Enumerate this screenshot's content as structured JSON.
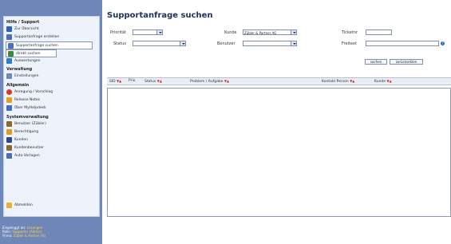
{
  "sidebar": {
    "sections": [
      {
        "title": "Hilfe / Support",
        "items": [
          {
            "label": "Zur Übersicht",
            "icon": "back-arrow-icon",
            "color": "#2f5fc4"
          },
          {
            "label": "Supportanfrage erstellen",
            "icon": "new-document-icon",
            "color": "#4a6fb8"
          },
          {
            "label": "Supportanfrage suchen",
            "icon": "search-document-icon",
            "color": "#4a6fb8"
          },
          {
            "label": "direkt suchen",
            "icon": "quick-search-icon",
            "color": "#3a8a3a"
          },
          {
            "label": "Auswertungen",
            "icon": "report-icon",
            "color": "#2f7fc4"
          }
        ]
      },
      {
        "title": "Verwaltung",
        "items": [
          {
            "label": "Einstellungen",
            "icon": "settings-icon",
            "color": "#6a8ac0"
          }
        ]
      },
      {
        "title": "Allgemein",
        "items": [
          {
            "label": "Anregung / Vorschlag",
            "icon": "suggestion-icon",
            "color": "#d23b2a"
          },
          {
            "label": "Release Notes",
            "icon": "release-notes-icon",
            "color": "#e0a020"
          },
          {
            "label": "Über MyHelpdesk",
            "icon": "info-icon",
            "color": "#3a6fc4"
          }
        ]
      },
      {
        "title": "Systemverwaltung",
        "items": [
          {
            "label": "Benutzer (Zübler)",
            "icon": "users-icon",
            "color": "#8a6a30"
          },
          {
            "label": "Berechtigung",
            "icon": "key-icon",
            "color": "#d8a020"
          },
          {
            "label": "Kunden",
            "icon": "customer-icon",
            "color": "#2a4a8a"
          },
          {
            "label": "Kundenbenutzer",
            "icon": "customer-users-icon",
            "color": "#8a6a30"
          },
          {
            "label": "Auto Vorlagen",
            "icon": "template-icon",
            "color": "#4a6fb8"
          }
        ]
      }
    ],
    "logout": {
      "label": "Abmelden",
      "icon": "logout-icon",
      "color": "#e8b030"
    },
    "footer": {
      "logged_in_label": "Eingeloggt als:",
      "logged_in_value": "Lösungen",
      "role_label": "Rolle:",
      "role_value": "Supporter (Admin)",
      "client_label": "Firma:",
      "client_value": "Zübler & Partner AG"
    }
  },
  "main": {
    "title": "Supportanfrage suchen",
    "filters": {
      "prioritaet_label": "Priorität",
      "prioritaet_value": "",
      "status_label": "Status",
      "status_value": "",
      "kunde_label": "Kunde",
      "kunde_value": "Zübler & Partner AG",
      "benutzer_label": "Benutzer",
      "benutzer_value": "",
      "ticketnr_label": "Ticketnr",
      "ticketnr_value": "",
      "freitext_label": "Freitext",
      "freitext_value": ""
    },
    "buttons": {
      "search": "suchen",
      "reset": "zurücksetzen"
    },
    "grid": {
      "columns": [
        "SID",
        "Prio",
        "Status",
        "Problem / Aufgabe",
        "Kontakt Person",
        "Kunde"
      ],
      "sort_marker": "▼▲",
      "rows": []
    }
  }
}
